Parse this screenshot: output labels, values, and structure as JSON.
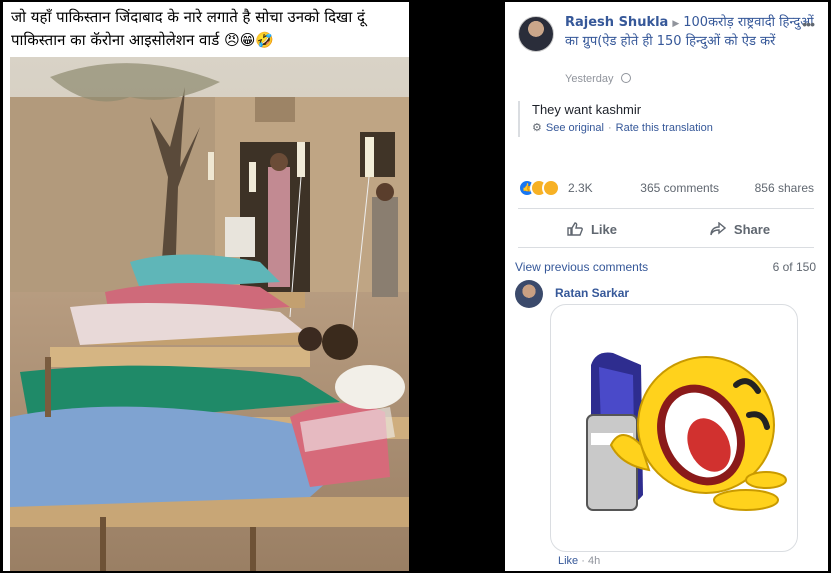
{
  "caption": "जो यहाँ पाकिस्तान जिंदाबाद के नारे लगाते है सोचा उनको दिखा दूं पाकिस्तान का कॅरोना आइसोलेशन वार्ड 😠😁🤣",
  "post": {
    "author": "Rajesh Shukla",
    "group": "100करोड़ राष्ट्रवादी हिन्दुओं का ग्रुप(ऐड होते ही 150 हिन्दुओं को ऐड करें",
    "timestamp": "Yesterday",
    "translated_text": "They want kashmir",
    "see_original": "See original",
    "rate_translation": "Rate this translation",
    "reaction_count": "2.3K",
    "comments_count": "365 comments",
    "shares_count": "856 shares",
    "like_label": "Like",
    "share_label": "Share"
  },
  "comments": {
    "view_previous": "View previous comments",
    "page_count": "6 of 150",
    "items": [
      {
        "author": "Ratan Sarkar",
        "like_label": "Like",
        "separator": "·",
        "time": "4h"
      }
    ]
  },
  "colors": {
    "link": "#365899",
    "muted": "#606770",
    "reaction_like": "#1877f2",
    "reaction_emoji": "#f7b125"
  },
  "icons": [
    "avatar",
    "more-options-icon",
    "globe-icon",
    "gear-icon",
    "like-reaction-icon",
    "haha-reaction-icon",
    "sad-reaction-icon",
    "thumbs-up-icon",
    "share-arrow-icon",
    "laughing-sticker"
  ]
}
